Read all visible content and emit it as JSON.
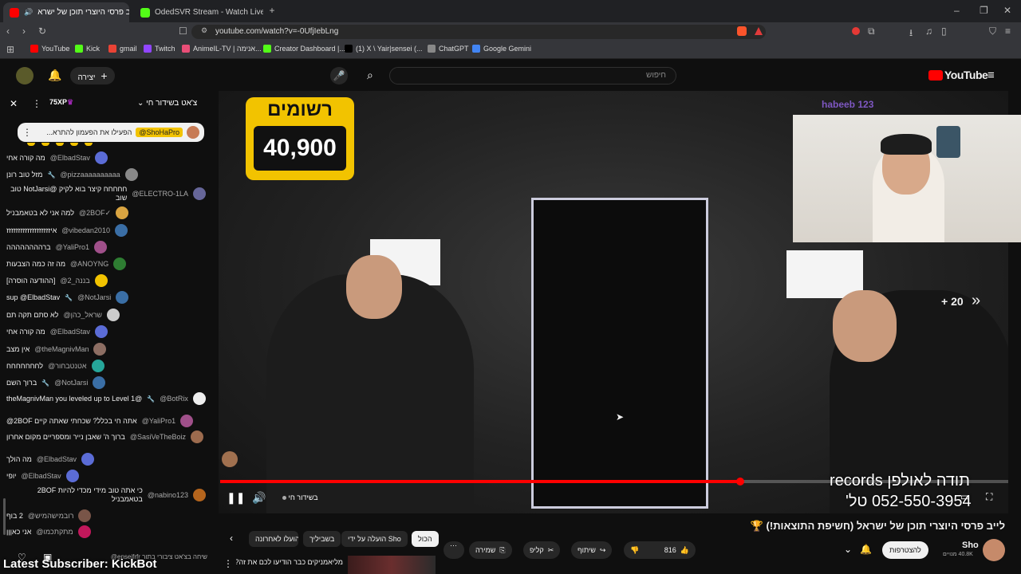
{
  "tabs": [
    {
      "label": "לייב פרסי היוצרי תוכן של ישרא",
      "active": true
    },
    {
      "label": "OdedSVR Stream - Watch Live on Kic",
      "active": false
    }
  ],
  "address": {
    "url": "youtube.com/watch?v=-0UfjIebLng"
  },
  "bookmarks": [
    {
      "label": "YouTube",
      "color": "#ff0000"
    },
    {
      "label": "Kick",
      "color": "#53fc18"
    },
    {
      "label": "gmail",
      "color": "#ea4335"
    },
    {
      "label": "Twitch",
      "color": "#9146ff"
    },
    {
      "label": "AnimeIL-TV | אנימה...",
      "color": "#e94e77"
    },
    {
      "label": "Creator Dashboard |...",
      "color": "#53fc18"
    },
    {
      "label": "(1) X \\ Yair|sensei (...",
      "color": "#000000"
    },
    {
      "label": "ChatGPT",
      "color": "#888888"
    },
    {
      "label": "Google Gemini",
      "color": "#4285f4"
    }
  ],
  "header": {
    "create_label": "יצירה",
    "search_placeholder": "חיפוש",
    "logo": "YouTube"
  },
  "chat": {
    "header_title": "צ'אט בשידור חי",
    "xp_badge": "75XP",
    "pinned": {
      "author": "@ShoHaPro",
      "text": "הפעילו את הפעמון להתרא..."
    },
    "messages": [
      {
        "author": "@ElbadStav",
        "text": "מה קורה אחי",
        "color": "#5b6cd6"
      },
      {
        "author": "@pizzaaaaaaaaaa",
        "text": "מזל טוב רונן",
        "color": "#888888",
        "badge": true
      },
      {
        "author": "@ELECTRO-1LA",
        "text": "חחחחח קיצר בוא לקיק @NotJarsi טוב שוב",
        "color": "#666699"
      },
      {
        "author": "@2BOF✓",
        "text": "למה אני לא בטאמבניל",
        "color": "#d9a441"
      },
      {
        "author": "@vibedan2010",
        "text": "איזזזזזזזזזזזזזזזזזזז",
        "color": "#3a6ea5"
      },
      {
        "author": "@YaliPro1",
        "text": "ברהההההההה",
        "color": "#a0508a"
      },
      {
        "author": "@ANOYNG",
        "text": "מה זה כמה הצבעות",
        "color": "#2e7d32"
      },
      {
        "author": "@בננה_2",
        "text": "[ההודעה הוסרה]",
        "color": "#f2c300"
      },
      {
        "author": "@NotJarsi",
        "text": "sup @ElbadStav",
        "color": "#3a6ea5",
        "badge": true
      },
      {
        "author": "@שראל_כהן",
        "text": "לא סתם תקה תם",
        "color": "#cccccc"
      },
      {
        "author": "@ElbadStav",
        "text": "מה קורה אחי",
        "color": "#5b6cd6"
      },
      {
        "author": "@theMagnivMan",
        "text": "אין מצב",
        "color": "#8d6e63"
      },
      {
        "author": "@אטנטבחור",
        "text": "לחחחחחחח",
        "color": "#26a69a"
      },
      {
        "author": "@NotJarsi",
        "text": "ברוך השם",
        "color": "#3a6ea5",
        "badge": true
      },
      {
        "author": "@BotRix",
        "text": "@theMagnivMan you leveled up to Level 1",
        "color": "#eeeeee",
        "badge": true
      },
      {
        "author": "@YaliPro1",
        "text": "אתה חי בכלל? שכחתי שאתה קיים 2BOF@",
        "color": "#a0508a"
      },
      {
        "author": "@SasiVeTheBoiz",
        "text": "ברוך ה' שאבן נייר ומספריים מקום אחרון",
        "color": "#9c6b4e"
      },
      {
        "author": "@ElbadStav",
        "text": "מה הולך",
        "color": "#5b6cd6"
      },
      {
        "author": "@ElbadStav",
        "text": "יופי",
        "color": "#5b6cd6"
      },
      {
        "author": "@nabino123",
        "text": "כי אתה טוב מידי מכדי להיות 2BOF בטאמבניל",
        "color": "#b5651d"
      },
      {
        "author": "@רובמישהמיש",
        "text": "2 בוף",
        "color": "#795548"
      },
      {
        "author": "@מתקתכמו",
        "text": "אני כאןןן",
        "color": "#c2185b"
      }
    ],
    "input_placeholder": "שיחה בצ'אט ציבורי בתור enseifrfr@",
    "latest_subscriber": "Latest Subscriber: KickBot"
  },
  "player": {
    "overlay_title": "רשומים",
    "overlay_count": "40,900",
    "skip_label": "+ 20",
    "live_label": "בשידור חי",
    "caption_line1": "תודה לאולפן records",
    "caption_line2": "052-550-3954 טל'",
    "cam_name": "habeeb 123",
    "progress": 0.66
  },
  "video": {
    "title": "לייב פרסי היוצרי תוכן של ישראל (חשיפת התוצאות!) 🏆",
    "channel": "Sho",
    "subs": "40.8K מנויים",
    "subscribe_label": "להצטרפות",
    "likes": "816",
    "share_label": "שיתוף",
    "clip_label": "קליפ",
    "save_label": "שמירה"
  },
  "chips": [
    "הכול",
    "הועלה על ידי Sho",
    "בשביליך",
    "הועלו לאחרונה"
  ],
  "recommendation": {
    "title": "מליאמניקים כבר הודיעו לכם את זה?"
  }
}
